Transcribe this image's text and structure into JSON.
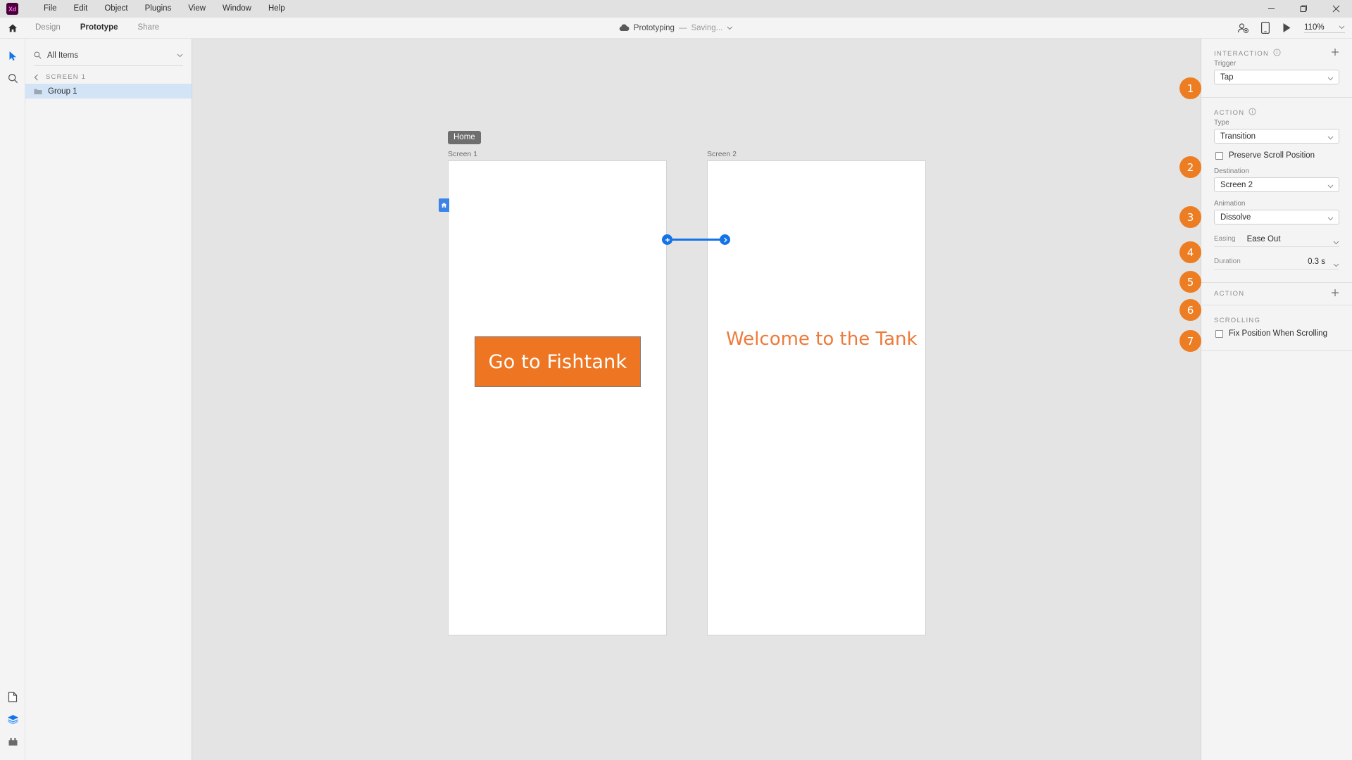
{
  "window": {
    "app_logo_text": "Xd",
    "menus": [
      "File",
      "Edit",
      "Object",
      "Plugins",
      "View",
      "Window",
      "Help"
    ],
    "controls": {
      "minimize": "minimize-icon",
      "maximize": "maximize-icon",
      "close": "close-icon"
    }
  },
  "toolbar": {
    "home_icon": "home-icon",
    "tabs": [
      {
        "label": "Design",
        "active": false
      },
      {
        "label": "Prototype",
        "active": true
      },
      {
        "label": "Share",
        "active": false
      }
    ],
    "document": {
      "cloud_icon": "cloud-icon",
      "name": "Prototyping",
      "separator": "—",
      "status": "Saving...",
      "chevron": "chevron-down-icon"
    },
    "right": {
      "invite_icon": "invite-user-icon",
      "device_preview_icon": "mobile-device-icon",
      "play_icon": "play-icon",
      "zoom_level": "110%",
      "zoom_chevron": "chevron-down-icon"
    }
  },
  "left_rail": {
    "top_icons": [
      {
        "name": "select-tool-icon",
        "active": true
      },
      {
        "name": "zoom-tool-icon",
        "active": false
      }
    ],
    "bottom_icons": [
      {
        "name": "assets-panel-icon",
        "active": false
      },
      {
        "name": "layers-panel-icon",
        "active": true
      },
      {
        "name": "plugins-panel-icon",
        "active": false
      }
    ]
  },
  "layers_panel": {
    "search": {
      "icon": "search-icon",
      "value": "All Items",
      "placeholder": "All Items",
      "chevron": "chevron-down-icon"
    },
    "breadcrumb": {
      "back_icon": "chevron-left-icon",
      "label": "SCREEN 1"
    },
    "items": [
      {
        "icon": "folder-icon",
        "name": "Group 1",
        "selected": true
      }
    ]
  },
  "canvas": {
    "background": "#e4e4e4",
    "artboards": [
      {
        "label": "Screen 1",
        "home_badge": "Home",
        "home_tab_icon": "home-icon",
        "elements": [
          {
            "type": "button",
            "text": "Go to Fishtank",
            "fill": "#EE7622",
            "text_color": "#ffffff"
          }
        ]
      },
      {
        "label": "Screen 2",
        "elements": [
          {
            "type": "text",
            "text": "Welcome to the Tank",
            "text_color": "#EE7A3A"
          }
        ]
      }
    ],
    "connection": {
      "color": "#1473E6",
      "source_handle_icon": "plus-handle-icon",
      "target_handle_icon": "arrow-handle-icon"
    }
  },
  "right_panel": {
    "interaction": {
      "title": "INTERACTION",
      "info_icon": "info-icon",
      "add_icon": "plus-icon",
      "trigger": {
        "label": "Trigger",
        "value": "Tap",
        "chevron": "chevron-down-icon"
      }
    },
    "action": {
      "title": "ACTION",
      "info_icon": "info-icon",
      "type": {
        "label": "Type",
        "value": "Transition",
        "chevron": "chevron-down-icon"
      },
      "preserve_scroll": {
        "label": "Preserve Scroll Position",
        "checked": false
      },
      "destination": {
        "label": "Destination",
        "value": "Screen 2",
        "chevron": "chevron-down-icon"
      },
      "animation": {
        "label": "Animation",
        "value": "Dissolve",
        "chevron": "chevron-down-icon"
      },
      "easing": {
        "label": "Easing",
        "value": "Ease Out",
        "chevron": "chevron-down-icon"
      },
      "duration": {
        "label": "Duration",
        "value": "0.3 s",
        "chevron": "chevron-down-icon"
      }
    },
    "action_add": {
      "title": "ACTION",
      "add_icon": "plus-icon"
    },
    "scrolling": {
      "title": "SCROLLING",
      "fix_position": {
        "label": "Fix Position When Scrolling",
        "checked": false
      }
    }
  },
  "annotations": {
    "color": "#ED7D22",
    "badges": [
      "1",
      "2",
      "3",
      "4",
      "5",
      "6",
      "7"
    ]
  }
}
